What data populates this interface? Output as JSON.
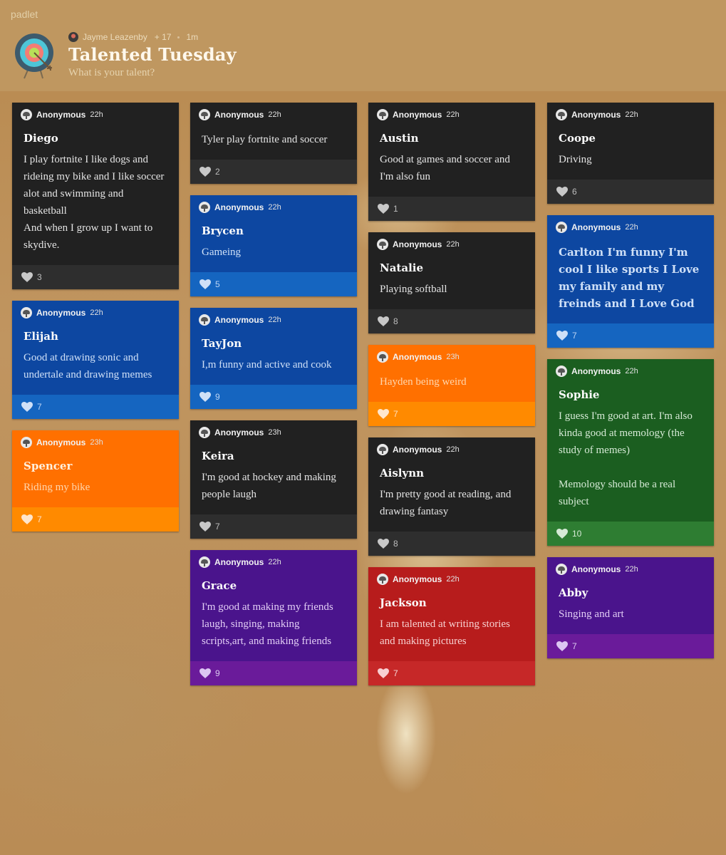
{
  "app": {
    "brand": "padlet"
  },
  "header": {
    "owner": "Jayme Leazenby",
    "contributors": "+ 17",
    "updated": "1m",
    "title": "Talented Tuesday",
    "subtitle": "What is your talent?"
  },
  "columns": [
    [
      {
        "theme": "dark",
        "author": "Anonymous",
        "time": "22h",
        "title": "Diego",
        "body": "I play fortnite  I like dogs and rideing my bike and I like soccer alot  and swimming and basketball\nAnd when I grow up I want to skydive.",
        "likes": "3"
      },
      {
        "theme": "blue",
        "author": "Anonymous",
        "time": "22h",
        "title": "Elijah",
        "body": "Good at drawing sonic and undertale and drawing memes",
        "likes": "7"
      },
      {
        "theme": "orange",
        "author": "Anonymous",
        "time": "23h",
        "title": "Spencer",
        "body": "Riding my bike",
        "likes": "7"
      }
    ],
    [
      {
        "theme": "dark",
        "author": "Anonymous",
        "time": "22h",
        "title": "",
        "body": "Tyler play fortnite and soccer",
        "likes": "2"
      },
      {
        "theme": "blue",
        "author": "Anonymous",
        "time": "22h",
        "title": "Brycen",
        "body": "Gameing",
        "likes": "5"
      },
      {
        "theme": "blue",
        "author": "Anonymous",
        "time": "22h",
        "title": "TayJon",
        "body": "I,m funny and active and cook",
        "likes": "9"
      },
      {
        "theme": "dark",
        "author": "Anonymous",
        "time": "23h",
        "title": "Keira",
        "body": "I'm good at hockey and making people laugh",
        "likes": "7"
      },
      {
        "theme": "purple",
        "author": "Anonymous",
        "time": "22h",
        "title": "Grace",
        "body": "I'm good at making my friends laugh, singing, making scripts,art, and making friends",
        "likes": "9"
      }
    ],
    [
      {
        "theme": "dark",
        "author": "Anonymous",
        "time": "22h",
        "title": "Austin",
        "body": "Good at games and soccer and I'm also fun",
        "likes": "1"
      },
      {
        "theme": "dark",
        "author": "Anonymous",
        "time": "22h",
        "title": "Natalie",
        "body": "Playing softball",
        "likes": "8"
      },
      {
        "theme": "orange",
        "author": "Anonymous",
        "time": "23h",
        "title": "",
        "body": "Hayden being weird",
        "likes": "7"
      },
      {
        "theme": "dark",
        "author": "Anonymous",
        "time": "22h",
        "title": "Aislynn",
        "body": "I'm pretty good at reading, and drawing fantasy",
        "likes": "8"
      },
      {
        "theme": "red",
        "author": "Anonymous",
        "time": "22h",
        "title": "Jackson",
        "body": "I am talented at writing stories and making pictures",
        "likes": "7"
      }
    ],
    [
      {
        "theme": "dark",
        "author": "Anonymous",
        "time": "22h",
        "title": "Coope",
        "body": "Driving",
        "likes": "6"
      },
      {
        "theme": "blue",
        "author": "Anonymous",
        "time": "22h",
        "title": "Carlton I'm funny I'm cool I like sports I Love my family and my freinds and I Love God",
        "body": "",
        "likes": "7"
      },
      {
        "theme": "green",
        "author": "Anonymous",
        "time": "22h",
        "title": "Sophie",
        "body": "I guess I'm good at art. I'm also kinda good at memology (the study of memes)\n\nMemology should be a real subject",
        "likes": "10"
      },
      {
        "theme": "purple",
        "author": "Anonymous",
        "time": "22h",
        "title": "Abby",
        "body": "Singing and art",
        "likes": "7"
      }
    ]
  ],
  "theme_colors": {
    "dark": "#212121",
    "blue": "#0d47a1",
    "orange": "#ff7000",
    "purple": "#4a148c",
    "red": "#b71c1c",
    "green": "#1b5e20"
  }
}
